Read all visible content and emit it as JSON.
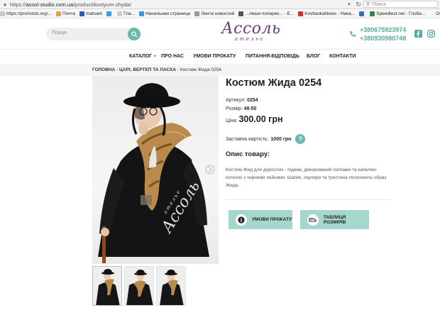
{
  "browser": {
    "url_prefix": "https://",
    "url_host": "assol-studio.com.ua",
    "url_path": "/product/kostyum-zhyda/",
    "search_placeholder": "Поиск",
    "bookmarks": [
      {
        "label": "https://prorivists.org/...",
        "color": "#c8c8c8"
      },
      {
        "label": "Почта",
        "color": "#e3a23a"
      },
      {
        "label": "matsam",
        "color": "#2f5aa8"
      },
      {
        "label": "",
        "color": "#3aa0e0"
      },
      {
        "label": "Гла...",
        "color": "#cfcfcf"
      },
      {
        "label": "Начальная страница",
        "color": "#4a90d9"
      },
      {
        "label": "Лента новостей",
        "color": "#999999"
      },
      {
        "label": "...лиши поперек... - E...",
        "color": "#555555"
      },
      {
        "label": "KovbaskaNews - Ника...",
        "color": "#cc3333"
      },
      {
        "label": "",
        "color": "#3d6fb4"
      },
      {
        "label": "Speedtest.net - Глоба...",
        "color": "#2a8a4a"
      },
      {
        "label": "OOO",
        "color": "#f7f7f7"
      }
    ]
  },
  "header": {
    "search_placeholder": "Пошук",
    "logo_main": "Ассоль",
    "logo_sub": "ательє",
    "phones": [
      "+380675923974",
      "+380930980748"
    ]
  },
  "nav": {
    "items": [
      "КАТАЛОГ",
      "ПРО НАС",
      "УМОВИ ПРОКАТУ",
      "ПИТАННЯ-ВІДПОВІДЬ",
      "БЛОГ",
      "КОНТАКТИ"
    ]
  },
  "breadcrumb": {
    "home": "ГОЛОВНА",
    "category": "ЦАРІ, ВЕРТЕП ТА ПАСХА",
    "current": "Костюм Жида 0254",
    "sep": "/"
  },
  "product": {
    "title": "Костюм Жида 0254",
    "article_label": "Артикул:",
    "article": "0254",
    "size_label": "Розмір:",
    "size": "48-50",
    "price_label": "Ціна:",
    "price": "300.00 грн",
    "deposit_label": "Заставна вартість:",
    "deposit": "1000 грн",
    "help_symbol": "?",
    "desc_heading": "Опис товару:",
    "description": "Костюм Жид для дорослих - піджак, декорований латками та капелюх-котелок з чорними пейсами. Шапик, окуляри та тростина посилюють образ Жида.",
    "watermark_main": "Ассоль",
    "watermark_sub": "ательє"
  },
  "actions": {
    "rental_terms": "УМОВИ ПРОКАТУ",
    "size_table": "ТАБЛИЦЯ РОЗМІРІВ"
  },
  "colors": {
    "accent": "#6ab7ac",
    "button_bg": "#a6d7ce",
    "logo": "#6c3a79"
  }
}
